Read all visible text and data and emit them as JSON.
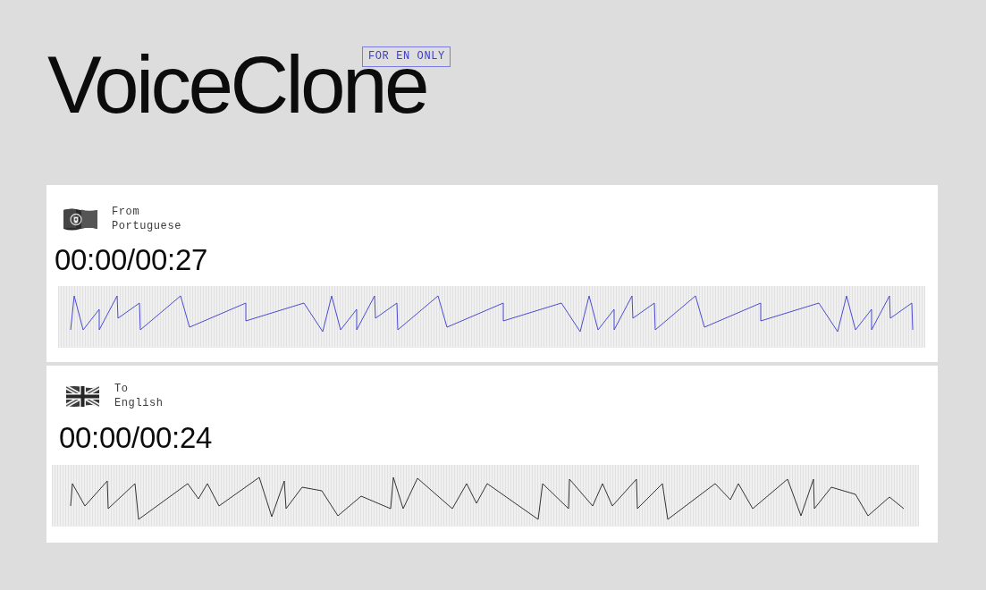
{
  "header": {
    "title": "VoiceClone",
    "badge": "FOR EN ONLY"
  },
  "panels": [
    {
      "direction": "From",
      "language": "Portuguese",
      "time": "00:00/00:27",
      "color": "#4b4bd2"
    },
    {
      "direction": "To",
      "language": "English",
      "time": "00:00/00:24",
      "color": "#333333"
    }
  ]
}
